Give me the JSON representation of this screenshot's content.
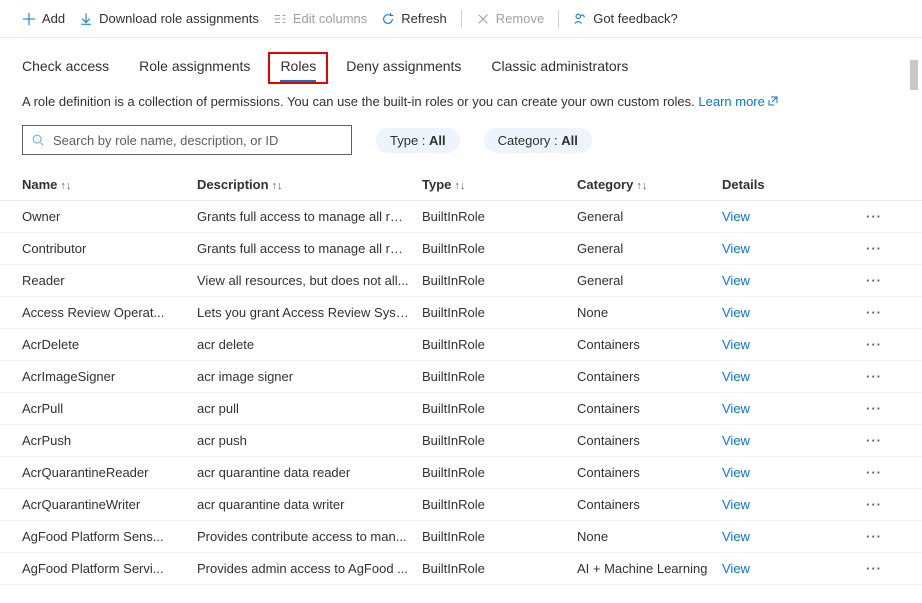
{
  "toolbar": {
    "add": "Add",
    "download": "Download role assignments",
    "edit_columns": "Edit columns",
    "refresh": "Refresh",
    "remove": "Remove",
    "feedback": "Got feedback?"
  },
  "tabs": {
    "check_access": "Check access",
    "role_assignments": "Role assignments",
    "roles": "Roles",
    "deny_assignments": "Deny assignments",
    "classic": "Classic administrators"
  },
  "description": {
    "text": "A role definition is a collection of permissions. You can use the built-in roles or you can create your own custom roles.",
    "learn_more": "Learn more"
  },
  "search": {
    "placeholder": "Search by role name, description, or ID"
  },
  "filters": {
    "type_label": "Type : ",
    "type_value": "All",
    "cat_label": "Category : ",
    "cat_value": "All"
  },
  "columns": {
    "name": "Name",
    "description": "Description",
    "type": "Type",
    "category": "Category",
    "details": "Details"
  },
  "view_label": "View",
  "rows": [
    {
      "name": "Owner",
      "description": "Grants full access to manage all res...",
      "type": "BuiltInRole",
      "category": "General"
    },
    {
      "name": "Contributor",
      "description": "Grants full access to manage all res...",
      "type": "BuiltInRole",
      "category": "General"
    },
    {
      "name": "Reader",
      "description": "View all resources, but does not all...",
      "type": "BuiltInRole",
      "category": "General"
    },
    {
      "name": "Access Review Operat...",
      "description": "Lets you grant Access Review Syste...",
      "type": "BuiltInRole",
      "category": "None"
    },
    {
      "name": "AcrDelete",
      "description": "acr delete",
      "type": "BuiltInRole",
      "category": "Containers"
    },
    {
      "name": "AcrImageSigner",
      "description": "acr image signer",
      "type": "BuiltInRole",
      "category": "Containers"
    },
    {
      "name": "AcrPull",
      "description": "acr pull",
      "type": "BuiltInRole",
      "category": "Containers"
    },
    {
      "name": "AcrPush",
      "description": "acr push",
      "type": "BuiltInRole",
      "category": "Containers"
    },
    {
      "name": "AcrQuarantineReader",
      "description": "acr quarantine data reader",
      "type": "BuiltInRole",
      "category": "Containers"
    },
    {
      "name": "AcrQuarantineWriter",
      "description": "acr quarantine data writer",
      "type": "BuiltInRole",
      "category": "Containers"
    },
    {
      "name": "AgFood Platform Sens...",
      "description": "Provides contribute access to man...",
      "type": "BuiltInRole",
      "category": "None"
    },
    {
      "name": "AgFood Platform Servi...",
      "description": "Provides admin access to AgFood ...",
      "type": "BuiltInRole",
      "category": "AI + Machine Learning"
    }
  ]
}
